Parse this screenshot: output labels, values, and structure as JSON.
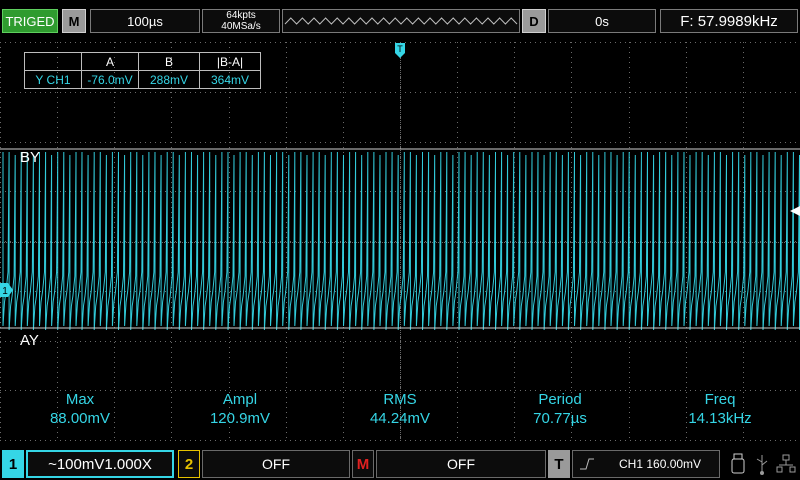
{
  "top": {
    "trigger_status": "TRIGED",
    "menu_button": "M",
    "timebase": "100µs",
    "memory_depth": "64kpts",
    "sample_rate": "40MSa/s",
    "delay_button": "D",
    "delay_value": "0s",
    "frequency": "F: 57.9989kHz"
  },
  "markers": {
    "trigger_top": "T",
    "cursor_b": "BY",
    "cursor_a": "AY",
    "ch1_marker": "1"
  },
  "cursor_table": {
    "headers": [
      "",
      "A",
      "B",
      "|B-A|"
    ],
    "row": [
      "Y CH1",
      "-76.0mV",
      "288mV",
      "364mV"
    ]
  },
  "measurements": [
    {
      "name": "Max",
      "value": "88.00mV"
    },
    {
      "name": "Ampl",
      "value": "120.9mV"
    },
    {
      "name": "RMS",
      "value": "44.24mV"
    },
    {
      "name": "Period",
      "value": "70.77µs"
    },
    {
      "name": "Freq",
      "value": "14.13kHz"
    }
  ],
  "bottom": {
    "ch1_num": "1",
    "ch1_setting": "~100mV1.000X",
    "ch2_num": "2",
    "ch2_setting": "OFF",
    "math_num": "M",
    "math_setting": "OFF",
    "trigger_num": "T",
    "trigger_setting": "CH1 160.00mV"
  },
  "colors": {
    "ch1": "#35d6e6",
    "ch2": "#e6c200",
    "math": "#e02020",
    "triged": "#2f9b2f"
  }
}
